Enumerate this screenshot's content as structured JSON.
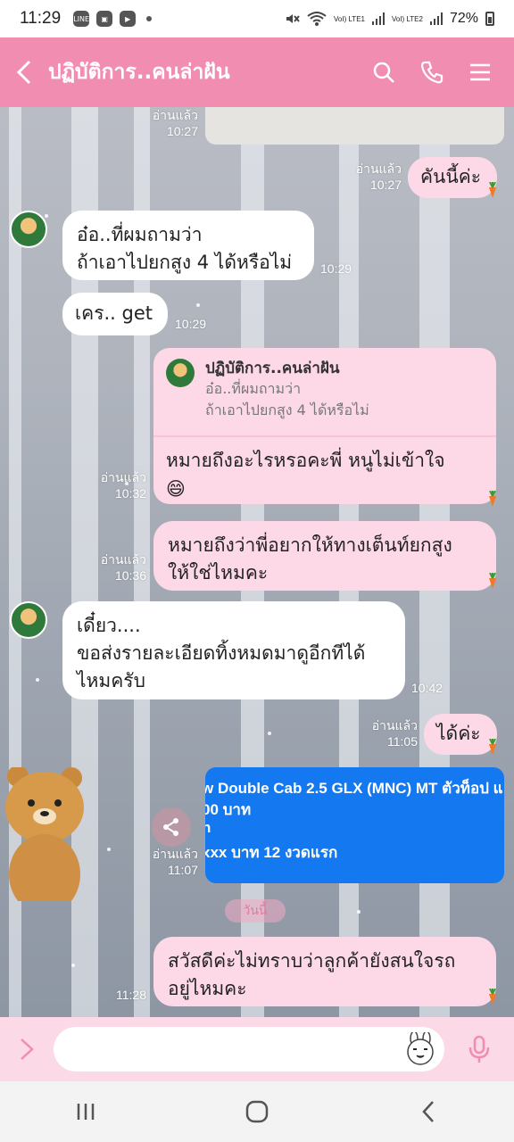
{
  "status_bar": {
    "time": "11:29",
    "app_icons": [
      "LINE",
      "sim",
      "tv"
    ],
    "lte1": "VoI) LTE1",
    "lte2": "VoI) LTE2",
    "battery": "72%"
  },
  "header": {
    "title": "ปฏิบัติการ..คนล่าฝัน",
    "background_color": "#f28db2"
  },
  "messages": [
    {
      "id": "m0",
      "side": "left",
      "read": "อ่านแล้ว",
      "time": "10:27"
    },
    {
      "id": "m1",
      "side": "right",
      "text": "คันนี้ค่ะ",
      "read": "อ่านแล้ว",
      "time": "10:27"
    },
    {
      "id": "m2",
      "side": "left",
      "lines": [
        "อ๋อ..ที่ผมถามว่า",
        "ถ้าเอาไปยกสูง 4 ได้หรือไม่"
      ],
      "time": "10:29"
    },
    {
      "id": "m3",
      "side": "left",
      "text": "เคร.. get",
      "time": "10:29"
    },
    {
      "id": "m4",
      "side": "right",
      "reply_to": {
        "name": "ปฏิบัติการ..คนล่าฝัน",
        "lines": [
          "อ๋อ..ที่ผมถามว่า",
          "ถ้าเอาไปยกสูง 4 ได้หรือไม่"
        ]
      },
      "lines": [
        "หมายถึงอะไรหรอคะพี่ หนูไม่เข้าใจ",
        "😄"
      ],
      "read": "อ่านแล้ว",
      "time": "10:32"
    },
    {
      "id": "m5",
      "side": "right",
      "lines": [
        "หมายถึงว่าพี่อยากให้ทางเต็นท์ยกสูง",
        "ให้ใช่ไหมคะ"
      ],
      "read": "อ่านแล้ว",
      "time": "10:36"
    },
    {
      "id": "m6",
      "side": "left",
      "lines": [
        "เดี๋ยว....",
        "ขอส่งรายละเอียดทิ้งหมดมาดูอีกทีได้",
        "ไหมครับ"
      ],
      "time": "10:42"
    },
    {
      "id": "m7",
      "side": "right",
      "text": "ได้ค่ะ",
      "read": "อ่านแล้ว",
      "time": "11:05"
    },
    {
      "id": "m8",
      "side": "right",
      "type": "image",
      "image_lines": [
        "w Double Cab 2.5 GLX (MNC) MT ตัวท็อป แ",
        "00 บาท",
        "n",
        "xxx บาท 12 งวดแรก"
      ],
      "read": "อ่านแล้ว",
      "time": "11:07"
    },
    {
      "id": "m9",
      "side": "right",
      "lines": [
        "สวัสดีค่ะไม่ทราบว่าลูกค้ายังสนใจรถ",
        "อยู่ไหมคะ"
      ],
      "time": "11:28"
    }
  ],
  "date_separator": "วันนี้",
  "input": {
    "placeholder": ""
  },
  "colors": {
    "accent": "#f28db2",
    "bubble_right": "#fdd9e7",
    "bubble_left": "#ffffff",
    "image_card": "#1479f0"
  },
  "icons": {
    "header": [
      "back-icon",
      "search-icon",
      "phone-icon",
      "menu-icon"
    ],
    "input": [
      "expand-icon",
      "sticker-icon",
      "mic-icon"
    ],
    "nav": [
      "recent-apps-icon",
      "home-icon",
      "back-nav-icon"
    ]
  }
}
